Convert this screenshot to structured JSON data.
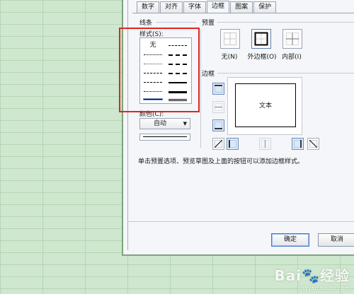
{
  "tabs": [
    "数字",
    "对齐",
    "字体",
    "边框",
    "图案",
    "保护"
  ],
  "active_tab": "边框",
  "line_group": {
    "title": "线条",
    "style_label": "样式(S):",
    "none_label": "无",
    "color_label": "颜色(C):",
    "color_value": "自动",
    "color_arrow": "▼"
  },
  "preset_group": {
    "title": "预置",
    "items": [
      {
        "label": "无(N)",
        "icon": "border-none-icon"
      },
      {
        "label": "外边框(O)",
        "icon": "border-outline-icon"
      },
      {
        "label": "内部(I)",
        "icon": "border-inside-icon"
      }
    ]
  },
  "border_group": {
    "title": "边框",
    "preview_text": "文本"
  },
  "hint": "单击预置选项、预览草图及上面的按钮可以添加边框样式。",
  "buttons": {
    "ok": "确定",
    "cancel": "取消"
  },
  "annotation_color": "#e0251f",
  "watermark": {
    "text": "Bai🐾经验",
    "sub": "jingyan.baidu.com"
  }
}
